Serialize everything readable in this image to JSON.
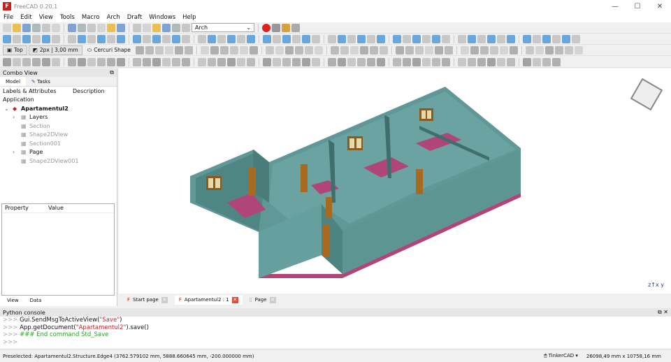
{
  "window": {
    "title": "FreeCAD 0.20.1"
  },
  "menu": [
    "File",
    "Edit",
    "View",
    "Tools",
    "Macro",
    "Arch",
    "Draft",
    "Windows",
    "Help"
  ],
  "toolbar": {
    "workbench": "Arch",
    "view_name": "Top",
    "line_style": "2px | 3,00 mm",
    "shape_label": "Cercuri Shape"
  },
  "combo": {
    "title": "Combo View",
    "tabs": [
      "Model",
      "Tasks"
    ],
    "col_labels": "Labels & Attributes",
    "col_desc": "Description",
    "application": "Application",
    "tree": [
      {
        "label": "Apartamentul2",
        "level": 0,
        "bold": true,
        "expander": "⌄"
      },
      {
        "label": "Layers",
        "level": 1,
        "expander": "›"
      },
      {
        "label": "Section",
        "level": 1,
        "hidden": true
      },
      {
        "label": "Shape2DView",
        "level": 1,
        "hidden": true
      },
      {
        "label": "Section001",
        "level": 1,
        "hidden": true
      },
      {
        "label": "Page",
        "level": 1,
        "expander": "›"
      },
      {
        "label": "Shape2DView001",
        "level": 1,
        "hidden": true
      }
    ],
    "prop_cols": [
      "Property",
      "Value"
    ],
    "bottom_tabs": [
      "View",
      "Data"
    ]
  },
  "doc_tabs": [
    {
      "label": "Start page"
    },
    {
      "label": "Apartamentul2 : 1",
      "active": true
    },
    {
      "label": "Page"
    }
  ],
  "console": {
    "title": "Python console",
    "lines": [
      {
        "p": ">>> ",
        "a": "Gui.SendMsgToActiveView(",
        "s": "\"Save\"",
        "b": ")"
      },
      {
        "p": ">>> ",
        "a": "App.getDocument(",
        "s": "\"Apartamentul2\"",
        "b": ").save()"
      },
      {
        "p": ">>> ",
        "c": "### End command Std_Save"
      },
      {
        "p": ">>> "
      }
    ]
  },
  "status": {
    "text": "Preselected: Apartamentul2.Structure.Edge4 (3762.579102 mm, 5888.660645 mm, -200.000000 mm)",
    "nav": "TinkerCAD",
    "dims": "26098,49 mm x 10758,16 mm"
  },
  "colors": {
    "wall": "#5f9896",
    "floor": "#b0457a",
    "accent": "#3a8fd8"
  }
}
